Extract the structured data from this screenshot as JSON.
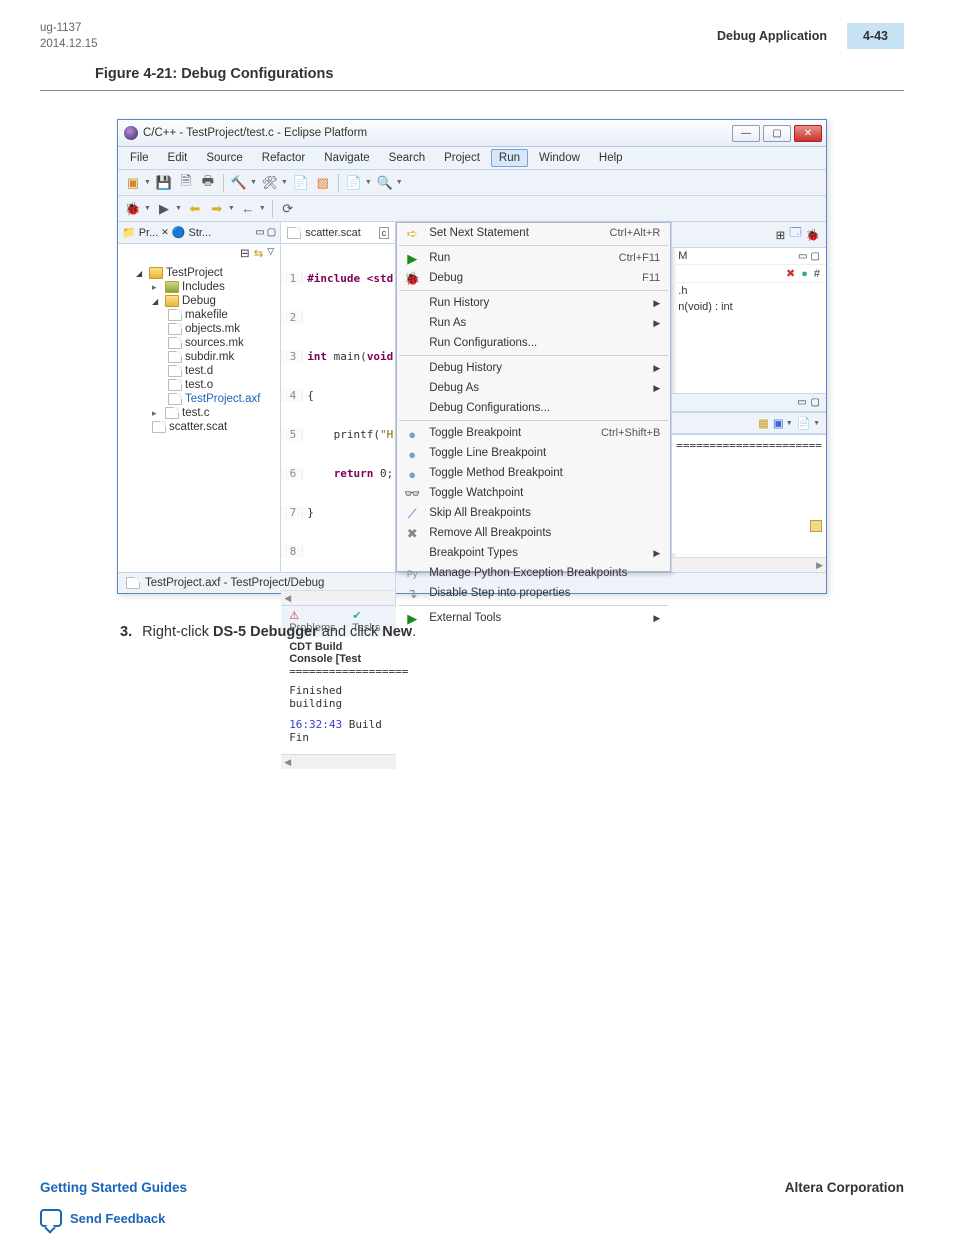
{
  "page_header": {
    "doc_id": "ug-1137",
    "date": "2014.12.15",
    "section_title": "Debug Application",
    "page_number": "4-43"
  },
  "figure_caption": "Figure 4-21: Debug Configurations",
  "window": {
    "title": "C/C++ - TestProject/test.c - Eclipse Platform",
    "menubar": [
      "File",
      "Edit",
      "Source",
      "Refactor",
      "Navigate",
      "Search",
      "Project",
      "Run",
      "Window",
      "Help"
    ],
    "selected_menu": "Run",
    "project_explorer": {
      "tabs": {
        "tab1": "Pr...",
        "tab2": "Str..."
      },
      "root": "TestProject",
      "includes": "Includes",
      "debug_folder": "Debug",
      "items": {
        "makefile": "makefile",
        "objects_mk": "objects.mk",
        "sources_mk": "sources.mk",
        "subdir_mk": "subdir.mk",
        "test_d": "test.d",
        "test_o": "test.o",
        "testproject_axf": "TestProject.axf"
      },
      "test_c": "test.c",
      "scatter": "scatter.scat"
    },
    "editor": {
      "tab_name": "scatter.scat",
      "lines": {
        "l1": "#include <std",
        "l2": "",
        "l3": "int main(void",
        "l4": "{",
        "l5": "    printf(\"H",
        "l6": "    return 0;",
        "l7": "}",
        "l8": ""
      }
    },
    "bottom_panel": {
      "tab_problems": "Problems",
      "tab_tasks": "Tasks",
      "console_title": "CDT Build Console [Test",
      "console_sep": "==================",
      "line1": "Finished building",
      "line2_ts": "16:32:43",
      "line2_rest": " Build Fin"
    },
    "run_menu": {
      "set_next": {
        "label": "Set Next Statement",
        "shortcut": "Ctrl+Alt+R"
      },
      "run": {
        "label": "Run",
        "shortcut": "Ctrl+F11"
      },
      "debug": {
        "label": "Debug",
        "shortcut": "F11"
      },
      "run_history": "Run History",
      "run_as": "Run As",
      "run_config": "Run Configurations...",
      "debug_history": "Debug History",
      "debug_as": "Debug As",
      "debug_config": "Debug Configurations...",
      "toggle_bp": {
        "label": "Toggle Breakpoint",
        "shortcut": "Ctrl+Shift+B"
      },
      "toggle_line_bp": "Toggle Line Breakpoint",
      "toggle_method_bp": "Toggle Method Breakpoint",
      "toggle_watchpoint": "Toggle Watchpoint",
      "skip_all_bp": "Skip All Breakpoints",
      "remove_all_bp": "Remove All Breakpoints",
      "bp_types": "Breakpoint Types",
      "manage_python_bp": "Manage Python Exception Breakpoints",
      "disable_step_into": "Disable Step into properties",
      "external_tools": "External Tools"
    },
    "right_panel": {
      "letter_m": "M",
      "h_file": ".h",
      "fn_sig": "n(void) : int",
      "equals_bar": "======================"
    },
    "statusbar": "TestProject.axf - TestProject/Debug"
  },
  "step": {
    "number": "3.",
    "prefix": "Right-click ",
    "bold1": "DS-5 Debugger",
    "mid": " and click ",
    "bold2": "New",
    "suffix": "."
  },
  "footer": {
    "left_link": "Getting Started Guides",
    "right_text": "Altera Corporation",
    "feedback": "Send Feedback"
  }
}
